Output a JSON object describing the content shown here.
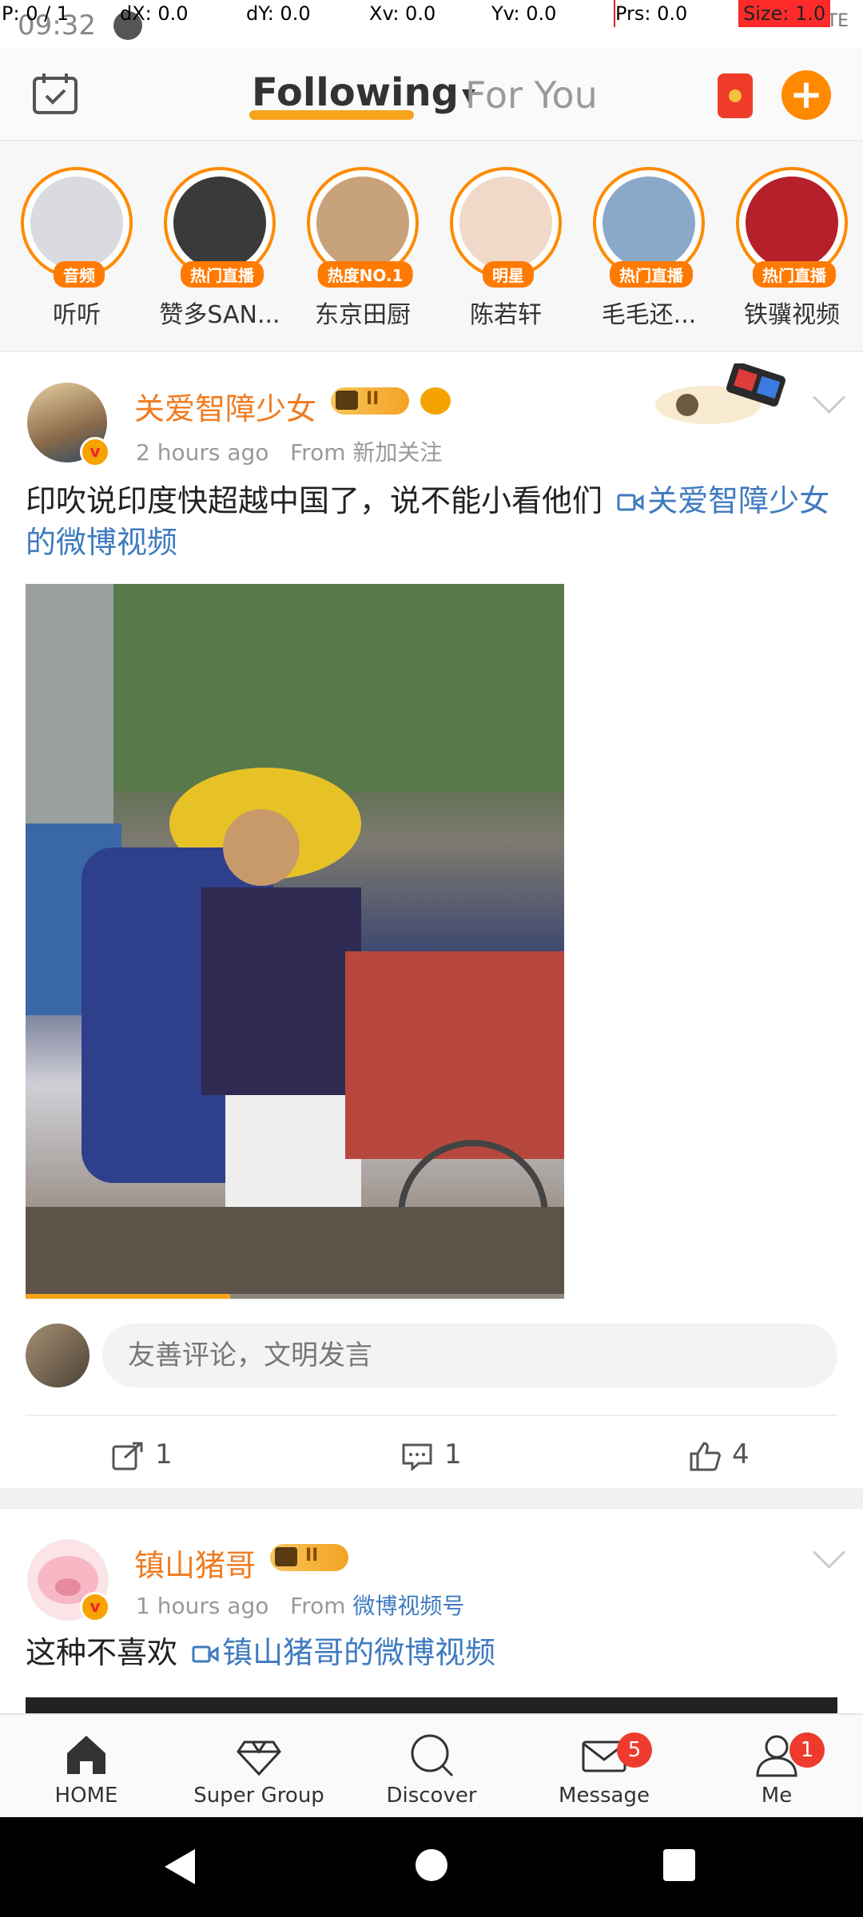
{
  "debug": {
    "p": "P: 0 / 1",
    "dx": "dX: 0.0",
    "dy": "dY: 0.0",
    "xv": "Xv: 0.0",
    "yv": "Yv: 0.0",
    "prs": "Prs: 0.0",
    "size": "Size: 1.0"
  },
  "status": {
    "time": "09:32",
    "signal": "LTE"
  },
  "header": {
    "following": "Following",
    "for_you": "For You",
    "plus": "+"
  },
  "stories": [
    {
      "name": "听听",
      "badge": "音频",
      "color": "#d9dbe0"
    },
    {
      "name": "赞多SAN...",
      "badge": "热门直播",
      "color": "#3a3a3a"
    },
    {
      "name": "东京田厨",
      "badge": "热度NO.1",
      "color": "#c7a27a"
    },
    {
      "name": "陈若轩",
      "badge": "明星",
      "color": "#f0d9c8"
    },
    {
      "name": "毛毛还...",
      "badge": "热门直播",
      "color": "#8aa9c9"
    },
    {
      "name": "铁骥视频",
      "badge": "热门直播",
      "color": "#b5202a"
    }
  ],
  "post1": {
    "username": "关爱智障少女",
    "level": "II",
    "time": "2 hours ago",
    "from_label": "From",
    "source": "新加关注",
    "text": "印吹说印度快超越中国了，说不能小看他们",
    "link": "关爱智障少女的微博视频",
    "comment_placeholder": "友善评论，文明发言",
    "reposts": "1",
    "comments": "1",
    "likes": "4",
    "video_progress": 0.38
  },
  "post2": {
    "username": "镇山猪哥",
    "level": "II",
    "time": "1 hours ago",
    "from_label": "From",
    "source": "微博视频号",
    "text": "这种不喜欢",
    "link": "镇山猪哥的微博视频"
  },
  "nav": {
    "home": "HOME",
    "super_group": "Super Group",
    "discover": "Discover",
    "message": "Message",
    "me": "Me",
    "message_badge": "5",
    "me_badge": "1"
  }
}
